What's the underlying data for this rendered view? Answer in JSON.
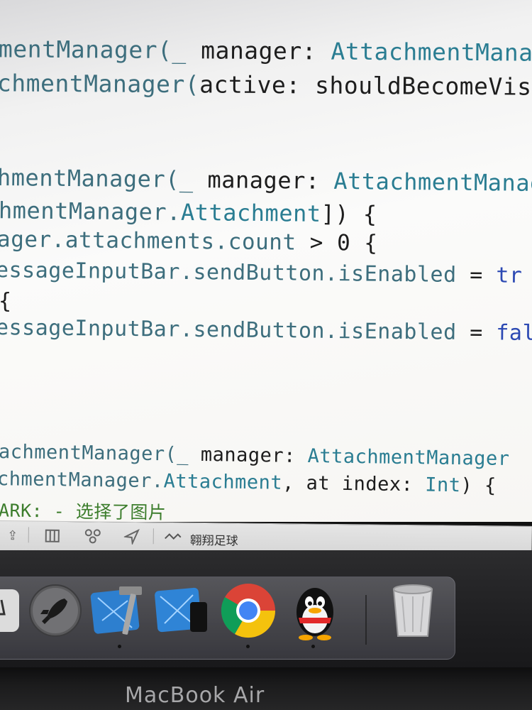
{
  "editor": {
    "lines": [
      [
        {
          "t": "mentManager(_ ",
          "c": "fn"
        },
        {
          "t": "manager: ",
          "c": "plain"
        },
        {
          "t": "AttachmentMana",
          "c": "type"
        }
      ],
      [
        {
          "t": "chmentManager(",
          "c": "fn"
        },
        {
          "t": "active: shouldBecomeVis",
          "c": "plain"
        }
      ],
      [
        {
          "t": "hmentManager(_ ",
          "c": "fn"
        },
        {
          "t": "manager: ",
          "c": "plain"
        },
        {
          "t": "AttachmentManag",
          "c": "type"
        }
      ],
      [
        {
          "t": "hmentManager.",
          "c": "fn"
        },
        {
          "t": "Attachment",
          "c": "type"
        },
        {
          "t": "]) {",
          "c": "plain"
        }
      ],
      [
        {
          "t": "ager.attachments.count",
          "c": "fn"
        },
        {
          "t": " > 0 {",
          "c": "plain"
        }
      ],
      [
        {
          "t": "essageInputBar.sendButton.isEnabled",
          "c": "fn"
        },
        {
          "t": " = ",
          "c": "plain"
        },
        {
          "t": "tr",
          "c": "true"
        }
      ],
      [
        {
          "t": "{",
          "c": "plain"
        }
      ],
      [
        {
          "t": "essageInputBar.sendButton.isEnabled",
          "c": "fn"
        },
        {
          "t": " = ",
          "c": "plain"
        },
        {
          "t": "fal",
          "c": "true"
        }
      ],
      [
        {
          "t": "achmentManager(_ ",
          "c": "fn"
        },
        {
          "t": "manager: ",
          "c": "plain"
        },
        {
          "t": "AttachmentManager",
          "c": "type"
        }
      ],
      [
        {
          "t": "chmentManager.",
          "c": "fn"
        },
        {
          "t": "Attachment",
          "c": "type"
        },
        {
          "t": ", at index: ",
          "c": "plain"
        },
        {
          "t": "Int",
          "c": "type"
        },
        {
          "t": ") {",
          "c": "plain"
        }
      ],
      [
        {
          "t": "ARK: - 选择了图片",
          "c": "comment"
        }
      ]
    ]
  },
  "toolbar": {
    "icons": [
      "share-icon",
      "split-view-icon",
      "scheme-icon",
      "location-icon",
      "console-icon"
    ],
    "label": "翱翔足球"
  },
  "dock": {
    "apps": [
      {
        "name": "finder-partial",
        "running": false
      },
      {
        "name": "launchpad",
        "running": false
      },
      {
        "name": "xcode",
        "running": true
      },
      {
        "name": "simulator",
        "running": false
      },
      {
        "name": "chrome",
        "running": true
      },
      {
        "name": "qq",
        "running": true
      },
      {
        "name": "trash",
        "running": false
      }
    ]
  },
  "bezel": {
    "brand": "MacBook Air"
  }
}
